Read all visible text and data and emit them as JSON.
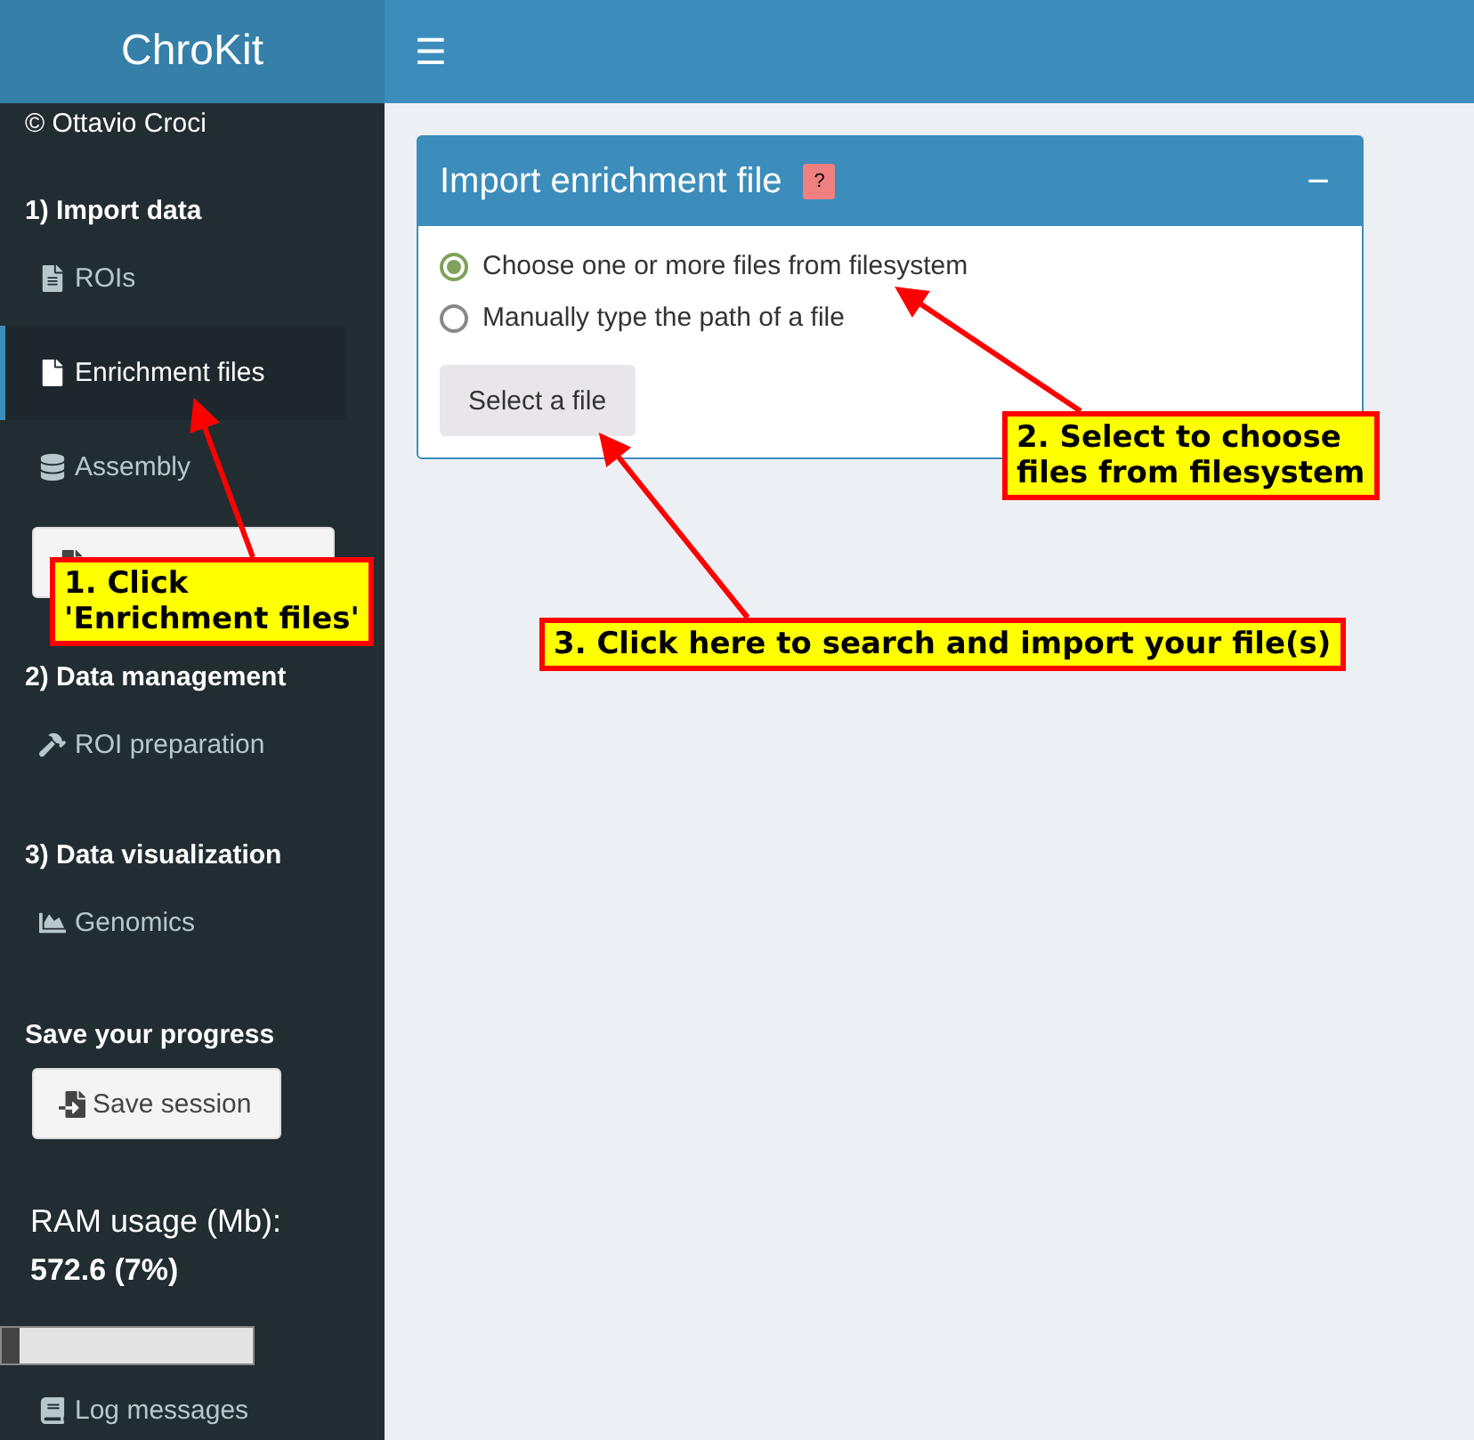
{
  "app": {
    "title": "ChroKit",
    "menu_icon": "☰"
  },
  "sidebar": {
    "copyright": "© Ottavio Croci",
    "sections": [
      {
        "heading": "1) Import data",
        "items": [
          {
            "kind": "link",
            "label": "ROIs",
            "selected": false
          },
          {
            "kind": "link",
            "label": "Enrichment files",
            "selected": true
          },
          {
            "kind": "link",
            "label": "Assembly",
            "selected": false
          },
          {
            "kind": "button"
          }
        ]
      },
      {
        "heading": "2) Data management",
        "items": [
          {
            "kind": "link",
            "label": "ROI preparation",
            "selected": false
          }
        ]
      },
      {
        "heading": "3) Data visualization",
        "items": [
          {
            "kind": "link",
            "label": "Genomics",
            "selected": false
          }
        ]
      },
      {
        "heading": "Save your progress",
        "items": [
          {
            "kind": "button",
            "label": "Save session"
          }
        ]
      }
    ],
    "ram": {
      "label": "RAM usage (Mb):",
      "value": "572.6 (7%)",
      "level": 0.07
    },
    "log_link": {
      "label": "Log messages"
    }
  },
  "panel": {
    "title": "Import enrichment file",
    "help": "?",
    "collapse": "−",
    "options": [
      {
        "label": "Choose one or more files from filesystem",
        "selected": true
      },
      {
        "label": "Manually type the path of a file",
        "selected": false
      }
    ],
    "button": "Select a file"
  },
  "annotations": [
    {
      "lines": [
        "1. Click",
        "'Enrichment files'"
      ]
    },
    {
      "lines": [
        "2. Select to choose",
        "files from filesystem"
      ]
    },
    {
      "lines": [
        "3. Click here to search and import your file(s)"
      ]
    }
  ]
}
